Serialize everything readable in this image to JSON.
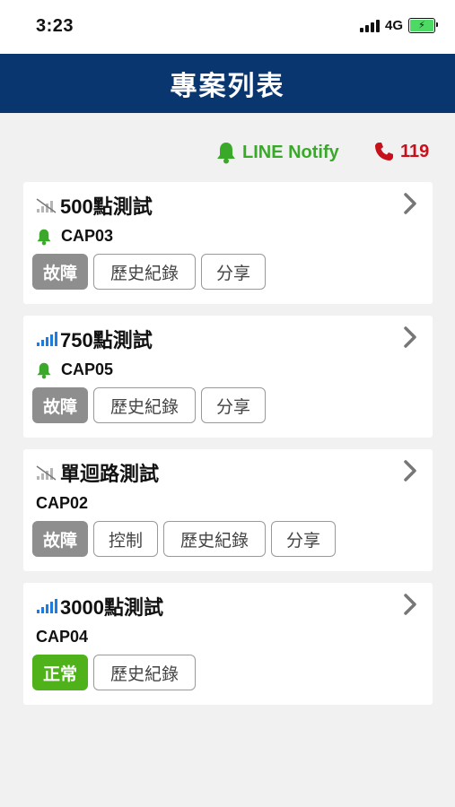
{
  "status_bar": {
    "time": "3:23",
    "network": "4G"
  },
  "header": {
    "title": "專案列表"
  },
  "toolbar": {
    "line_notify_label": "LINE Notify",
    "call_label": "119"
  },
  "colors": {
    "navbar": "#0a3670",
    "line_green": "#3aa92a",
    "call_red": "#c8101a",
    "fault_gray": "#8e8e8e",
    "normal_green": "#4fb21a",
    "signal_blue": "#1e7be0"
  },
  "projects": [
    {
      "name": "500點測試",
      "signal": "no-signal-icon",
      "device": "CAP03",
      "bell": true,
      "status": "故障",
      "buttons": [
        "歷史紀錄",
        "分享"
      ]
    },
    {
      "name": "750點測試",
      "signal": "full-signal-icon",
      "device": "CAP05",
      "bell": true,
      "status": "故障",
      "buttons": [
        "歷史紀錄",
        "分享"
      ]
    },
    {
      "name": "單迴路測試",
      "signal": "no-signal-icon",
      "device": "CAP02",
      "bell": false,
      "status": "故障",
      "buttons": [
        "控制",
        "歷史紀錄",
        "分享"
      ]
    },
    {
      "name": "3000點測試",
      "signal": "full-signal-icon",
      "device": "CAP04",
      "bell": false,
      "status": "正常",
      "buttons": [
        "歷史紀錄"
      ]
    }
  ]
}
